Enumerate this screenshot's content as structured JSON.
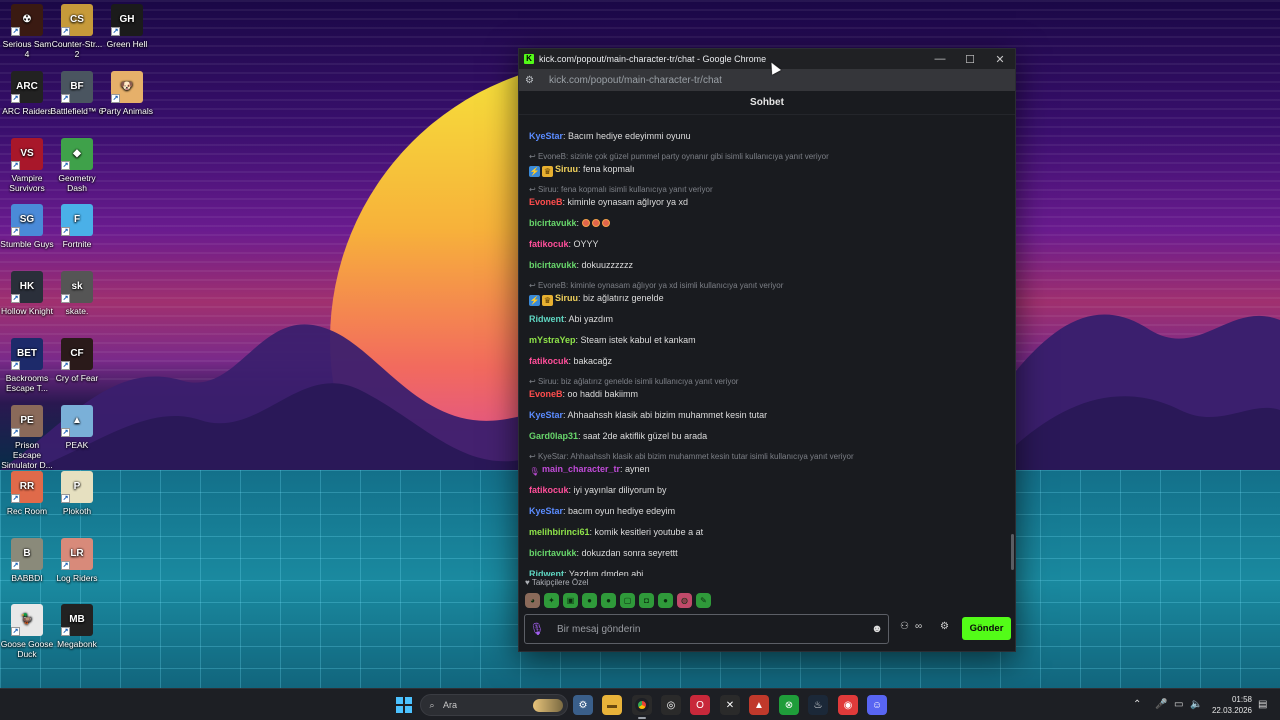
{
  "desktop": {
    "icons": [
      {
        "label": "Serious Sam 4",
        "color": "#3a1a12",
        "glyph": "☢"
      },
      {
        "label": "Counter-Str... 2",
        "color": "#c69a3a",
        "glyph": "CS"
      },
      {
        "label": "Green Hell",
        "color": "#1b1b1b",
        "glyph": "GH"
      },
      {
        "label": "ARC Raiders",
        "color": "#222",
        "glyph": "ARC"
      },
      {
        "label": "Battlefield™ 6",
        "color": "#4a5560",
        "glyph": "BF"
      },
      {
        "label": "Party Animals",
        "color": "#e6b06a",
        "glyph": "🐶"
      },
      {
        "label": "Vampire Survivors",
        "color": "#a8172a",
        "glyph": "VS"
      },
      {
        "label": "Geometry Dash",
        "color": "#3fa14a",
        "glyph": "◆"
      },
      {
        "label": "Stumble Guys",
        "color": "#4a8ad8",
        "glyph": "SG"
      },
      {
        "label": "Fortnite",
        "color": "#4ab0e8",
        "glyph": "F"
      },
      {
        "label": "Hollow Knight",
        "color": "#2a2f3a",
        "glyph": "HK"
      },
      {
        "label": "skate.",
        "color": "#555",
        "glyph": "sk"
      },
      {
        "label": "Backrooms Escape T...",
        "color": "#1d2a6a",
        "glyph": "BET"
      },
      {
        "label": "Cry of Fear",
        "color": "#2a1a1a",
        "glyph": "CF"
      },
      {
        "label": "Prison Escape Simulator D...",
        "color": "#8a6a5a",
        "glyph": "PE"
      },
      {
        "label": "PEAK",
        "color": "#7ab0d8",
        "glyph": "▲"
      },
      {
        "label": "Rec Room",
        "color": "#e06a4a",
        "glyph": "RR"
      },
      {
        "label": "Plokoth",
        "color": "#e6e0c0",
        "glyph": "P"
      },
      {
        "label": "BABBDI",
        "color": "#8a8a7a",
        "glyph": "B"
      },
      {
        "label": "Log Riders",
        "color": "#d88a7a",
        "glyph": "LR"
      },
      {
        "label": "Goose Goose Duck",
        "color": "#e8e8e8",
        "glyph": "🦆"
      },
      {
        "label": "Megabonk",
        "color": "#222",
        "glyph": "MB"
      }
    ]
  },
  "window": {
    "title": "kick.com/popout/main-character-tr/chat - Google Chrome",
    "url": "kick.com/popout/main-character-tr/chat",
    "tab_logo": "K",
    "chat_title": "Sohbet"
  },
  "chat": {
    "messages": [
      {
        "type": "msg",
        "user": "KyeStar",
        "color": "#5b8cff",
        "text": ": Bacım hediye edeyimmi oyunu"
      },
      {
        "type": "reply",
        "text": "EvoneB: sizinle çok güzel pummel party oynanır gibi isimli kullanıcıya yanıt veriyor"
      },
      {
        "type": "msg",
        "user": "Siruu",
        "color": "#f1d15b",
        "badges": true,
        "text": ": fena kopmalı"
      },
      {
        "type": "reply",
        "text": "Siruu: fena kopmalı isimli kullanıcıya yanıt veriyor"
      },
      {
        "type": "msg",
        "user": "EvoneB",
        "color": "#ff4d4d",
        "text": ": kiminle oynasam ağlıyor ya xd"
      },
      {
        "type": "msg",
        "user": "bicirtavukk",
        "color": "#68d66b",
        "emotes": 3,
        "text": ": "
      },
      {
        "type": "msg",
        "user": "fatikocuk",
        "color": "#ff4f9a",
        "text": ": OYYY"
      },
      {
        "type": "msg",
        "user": "bicirtavukk",
        "color": "#68d66b",
        "text": ": dokuuzzzzzz"
      },
      {
        "type": "reply",
        "text": "EvoneB: kiminle oynasam ağlıyor ya xd isimli kullanıcıya yanıt veriyor"
      },
      {
        "type": "msg",
        "user": "Siruu",
        "color": "#f1d15b",
        "badges": true,
        "text": ": biz ağlatırız genelde"
      },
      {
        "type": "msg",
        "user": "Ridwent",
        "color": "#5fd6c2",
        "text": ": Abi yazdım"
      },
      {
        "type": "msg",
        "user": "mYstraYep",
        "color": "#8fe34a",
        "text": ": Steam istek kabul et kankam"
      },
      {
        "type": "msg",
        "user": "fatikocuk",
        "color": "#ff4f9a",
        "text": ": bakacağz"
      },
      {
        "type": "reply",
        "text": "Siruu: biz ağlatırız genelde isimli kullanıcıya yanıt veriyor"
      },
      {
        "type": "msg",
        "user": "EvoneB",
        "color": "#ff4d4d",
        "text": ": oo haddi bakiimm"
      },
      {
        "type": "msg",
        "user": "KyeStar",
        "color": "#5b8cff",
        "text": ": Ahhaahssh klasik abi bizim muhammet kesin tutar"
      },
      {
        "type": "msg",
        "user": "Gard0lap31",
        "color": "#68d66b",
        "text": ": saat 2de aktiflik güzel bu arada"
      },
      {
        "type": "reply",
        "text": "KyeStar: Ahhaahssh klasik abi bizim muhammet kesin tutar isimli kullanıcıya yanıt veriyor"
      },
      {
        "type": "msg",
        "user": "main_character_tr",
        "color": "#c04bd8",
        "broadcaster": true,
        "text": ": aynen"
      },
      {
        "type": "msg",
        "user": "fatikocuk",
        "color": "#ff4f9a",
        "text": ": iyi yayınlar diliyorum by"
      },
      {
        "type": "msg",
        "user": "KyeStar",
        "color": "#5b8cff",
        "text": ": bacım oyun hediye edeyim"
      },
      {
        "type": "msg",
        "user": "melihbirinci61",
        "color": "#8fe34a",
        "text": ": komik kesitleri youtube a at"
      },
      {
        "type": "msg",
        "user": "bicirtavukk",
        "color": "#68d66b",
        "text": ": dokuzdan sonra seyrettt"
      },
      {
        "type": "msg",
        "user": "Ridwent",
        "color": "#5fd6c2",
        "text": ": Yazdım dmden abi"
      }
    ],
    "followers_label": "Takipçilere Özel",
    "emote_count": 10,
    "input_placeholder": "Bir mesaj gönderin",
    "send_label": "Gönder"
  },
  "taskbar": {
    "search_placeholder": "Ara",
    "time": "01:58",
    "date": "22.03.2026"
  },
  "colors": {
    "kick_green": "#53fc18",
    "chat_bg": "#191b1f"
  }
}
